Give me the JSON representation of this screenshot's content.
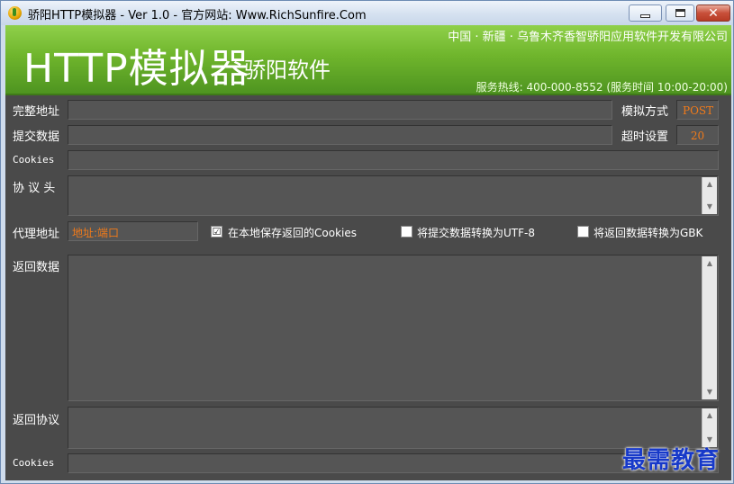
{
  "window": {
    "title": "骄阳HTTP模拟器 - Ver 1.0 - 官方网站: Www.RichSunfire.Com",
    "icon": "sun-icon",
    "minimize_icon": "minimize-icon",
    "maximize_icon": "maximize-icon",
    "close_glyph": "✕"
  },
  "banner": {
    "logo": "HTTP模拟器",
    "logo_sub": "骄阳软件",
    "company": "中国 · 新疆 · 乌鲁木齐香智骄阳应用软件开发有限公司",
    "hotline": "服务热线: 400-000-8552 (服务时间 10:00-20:00)"
  },
  "form": {
    "url_label": "完整地址",
    "url_value": "",
    "method_label": "模拟方式",
    "method_value": "POST",
    "postdata_label": "提交数据",
    "postdata_value": "",
    "timeout_label": "超时设置",
    "timeout_value": "20",
    "cookies_label": "Cookies",
    "cookies_value": "",
    "headers_label": "协 议 头",
    "headers_value": "",
    "proxy_label": "代理地址",
    "proxy_value": "地址:端口",
    "save_cookies_label": "在本地保存返回的Cookies",
    "save_cookies_checked": "☑",
    "utf8_label": "将提交数据转换为UTF-8",
    "gbk_label": "将返回数据转换为GBK",
    "response_label": "返回数据",
    "response_value": "",
    "resp_headers_label": "返回协议",
    "resp_headers_value": "",
    "resp_cookies_label": "Cookies",
    "resp_cookies_value": ""
  },
  "scroll": {
    "up": "▲",
    "down": "▼"
  },
  "watermark": "最需教育",
  "colors": {
    "banner_green": "#6fb52c",
    "panel_dark": "#4a4a4a",
    "value_orange": "#f07a1a",
    "watermark_blue": "#1739c9"
  }
}
